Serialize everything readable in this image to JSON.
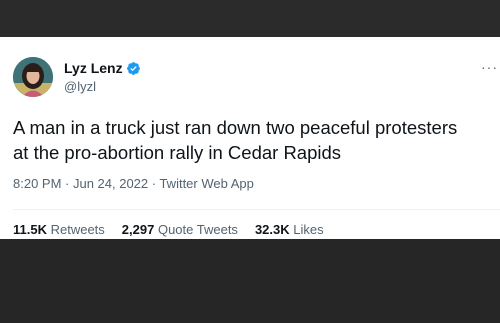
{
  "tweet": {
    "author": {
      "display_name": "Lyz Lenz",
      "handle": "@lyzl",
      "verified_icon": "verified-badge-icon"
    },
    "text_line_1": "A man in a truck just ran down two peaceful protesters",
    "text_line_2": "at the pro-abortion rally in Cedar Rapids",
    "timestamp": "8:20 PM · Jun 24, 2022 · Twitter Web App",
    "more_label": "···",
    "stats": {
      "retweets_count": "11.5K",
      "retweets_label": "Retweets",
      "quotes_count": "2,297",
      "quotes_label": "Quote Tweets",
      "likes_count": "32.3K",
      "likes_label": "Likes"
    }
  },
  "colors": {
    "text_primary": "#0f1419",
    "text_secondary": "#536471",
    "verified_blue": "#1d9bf0",
    "background_card": "#ffffff",
    "background_frame": "#2a2a2a"
  }
}
